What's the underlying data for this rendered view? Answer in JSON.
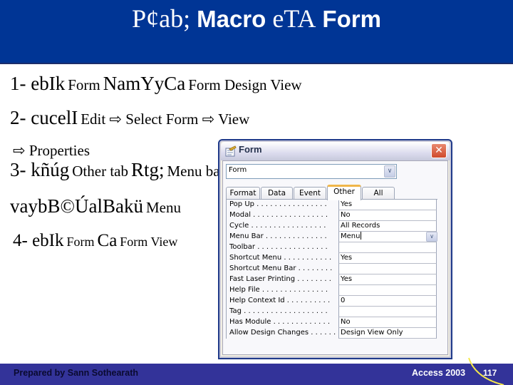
{
  "header": {
    "title_parts": [
      "P¢ab;",
      "Macro",
      "eTA",
      "Form"
    ]
  },
  "steps": [
    {
      "parts": [
        "1- ebIk",
        "Form",
        "NamYyCa",
        "Form Design View"
      ]
    },
    {
      "parts": [
        "2- cucelI",
        "Edit ⇨ Select Form ⇨ View"
      ]
    },
    {
      "parts": [
        "⇨ Properties"
      ]
    },
    {
      "parts": [
        "3- kñúg",
        "Other tab",
        "Rtg;",
        "Menu bar"
      ]
    },
    {
      "parts": [
        "vaybB©ÚalBakü",
        "Menu"
      ]
    },
    {
      "parts": [
        "4- ebIk",
        "Form",
        "Ca",
        "Form View"
      ]
    }
  ],
  "dialog": {
    "title": "Form",
    "close_icon": "close-icon",
    "object_selector": {
      "value": "Form"
    },
    "tabs": [
      "Format",
      "Data",
      "Event",
      "Other",
      "All"
    ],
    "active_tab": "Other",
    "properties": [
      {
        "name": "Pop Up . . . . . . . . . . . . . . . .",
        "value": "Yes"
      },
      {
        "name": "Modal . . . . . . . . . . . . . . . . .",
        "value": "No"
      },
      {
        "name": "Cycle . . . . . . . . . . . . . . . . .",
        "value": "All Records"
      },
      {
        "name": "Menu Bar . . . . . . . . . . . . . .",
        "value": "Menu"
      },
      {
        "name": "Toolbar . . . . . . . . . . . . . . . .",
        "value": ""
      },
      {
        "name": "Shortcut Menu . . . . . . . . . . .",
        "value": "Yes"
      },
      {
        "name": "Shortcut Menu Bar . . . . . . . .",
        "value": ""
      },
      {
        "name": "Fast Laser Printing . . . . . . . .",
        "value": "Yes"
      },
      {
        "name": "Help File . . . . . . . . . . . . . . .",
        "value": ""
      },
      {
        "name": "Help Context Id . . . . . . . . . .",
        "value": "0"
      },
      {
        "name": "Tag . . . . . . . . . . . . . . . . . . .",
        "value": ""
      },
      {
        "name": "Has Module . . . . . . . . . . . . .",
        "value": "No"
      },
      {
        "name": "Allow Design Changes . . . . . .",
        "value": "Design View Only"
      }
    ]
  },
  "footer": {
    "author": "Prepared by Sann Sothearath",
    "course": "Access 2003",
    "page_number": "117"
  },
  "colors": {
    "header_bg": "#003595",
    "footer_bg": "#333399",
    "accent_arc": "#f5e94a"
  }
}
